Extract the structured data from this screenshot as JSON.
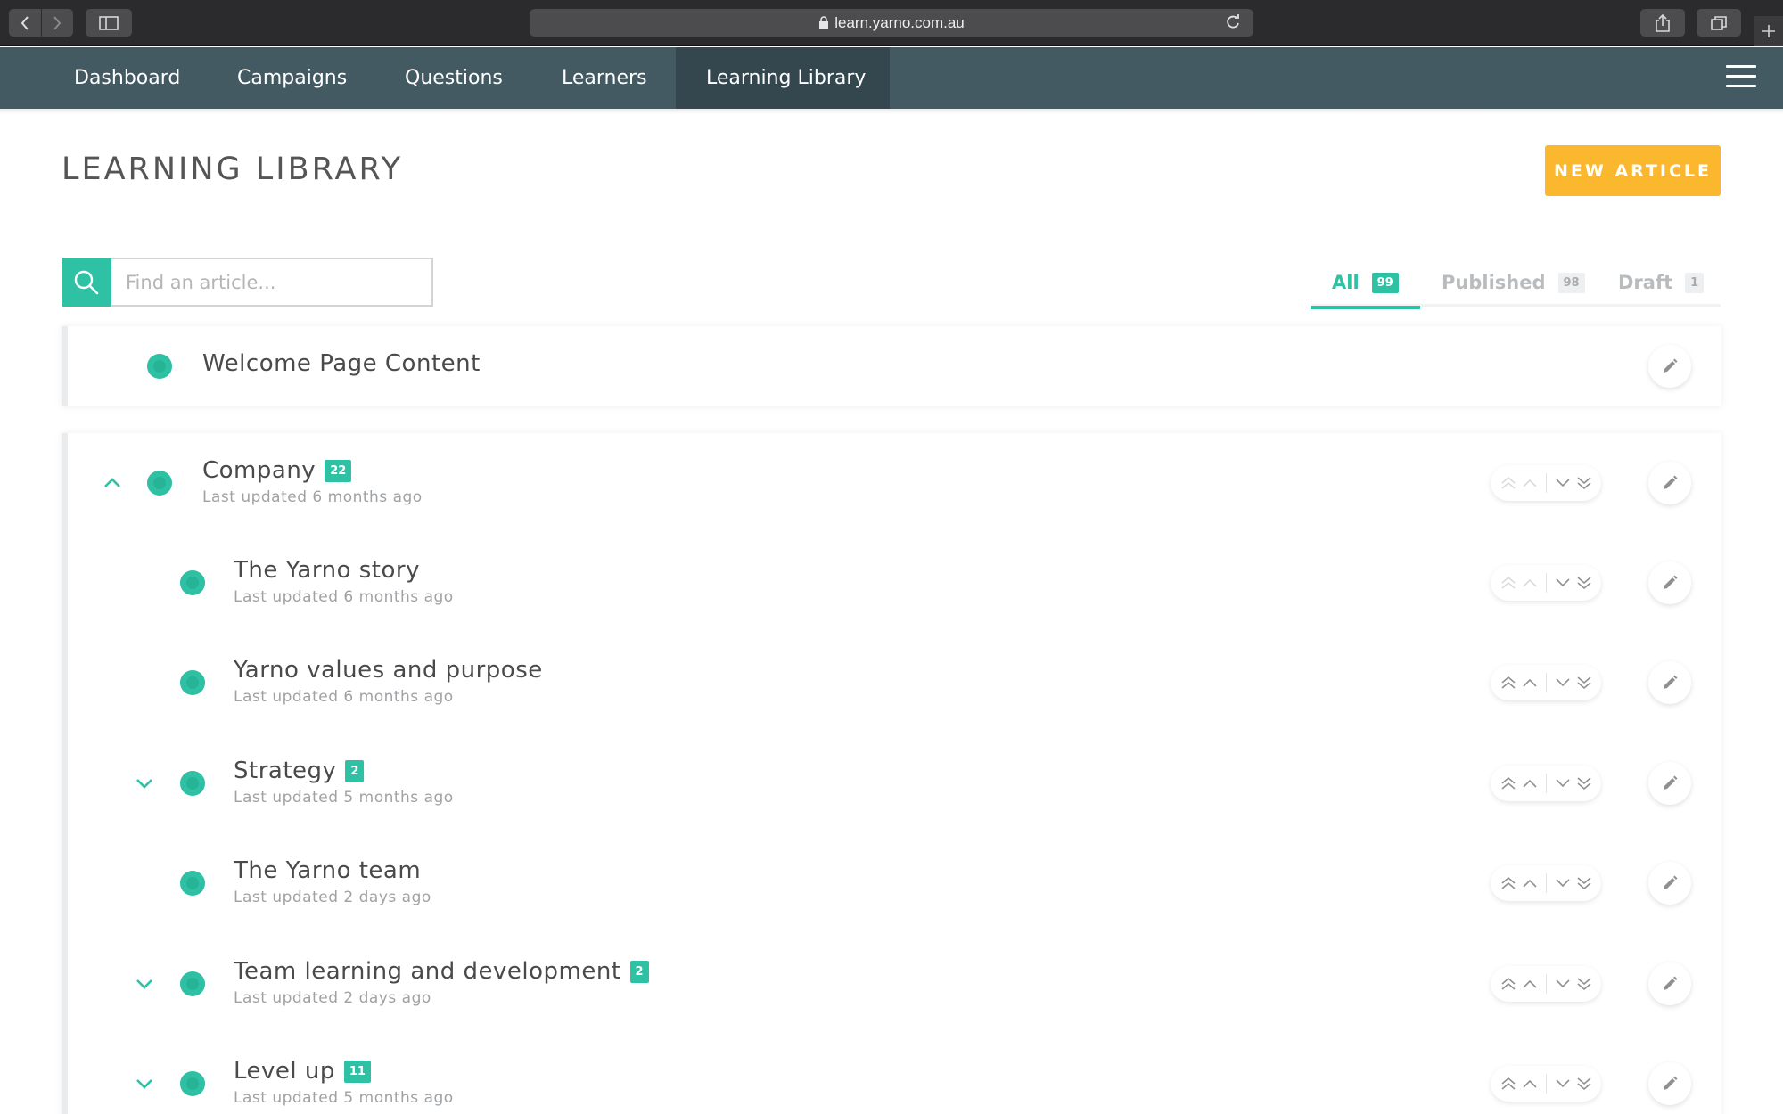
{
  "browser": {
    "url": "learn.yarno.com.au"
  },
  "nav": {
    "items": [
      {
        "label": "Dashboard",
        "active": false
      },
      {
        "label": "Campaigns",
        "active": false
      },
      {
        "label": "Questions",
        "active": false
      },
      {
        "label": "Learners",
        "active": false
      },
      {
        "label": "Learning Library",
        "active": true
      }
    ],
    "menu_icon": "hamburger-icon"
  },
  "page": {
    "title": "LEARNING LIBRARY",
    "new_article_label": "NEW ARTICLE"
  },
  "search": {
    "placeholder": "Find an article...",
    "value": ""
  },
  "filters": [
    {
      "label": "All",
      "count": "99",
      "active": true
    },
    {
      "label": "Published",
      "count": "98",
      "active": false
    },
    {
      "label": "Draft",
      "count": "1",
      "active": false
    }
  ],
  "articles": {
    "welcome": {
      "title": "Welcome Page Content"
    },
    "company": {
      "title": "Company",
      "count": "22",
      "updated": "Last updated 6 months ago",
      "expanded": true
    },
    "children": [
      {
        "title": "The Yarno story",
        "count": "",
        "updated": "Last updated 6 months ago",
        "has_children": false
      },
      {
        "title": "Yarno values and purpose",
        "count": "",
        "updated": "Last updated 6 months ago",
        "has_children": false
      },
      {
        "title": "Strategy",
        "count": "2",
        "updated": "Last updated 5 months ago",
        "has_children": true
      },
      {
        "title": "The Yarno team",
        "count": "",
        "updated": "Last updated 2 days ago",
        "has_children": false
      },
      {
        "title": "Team learning and development",
        "count": "2",
        "updated": "Last updated 2 days ago",
        "has_children": true
      },
      {
        "title": "Level up",
        "count": "11",
        "updated": "Last updated 5 months ago",
        "has_children": true
      }
    ]
  },
  "colors": {
    "accent": "#2fc1a3",
    "nav_bg": "#445a63",
    "nav_active": "#34474f",
    "button": "#fbb72d"
  }
}
